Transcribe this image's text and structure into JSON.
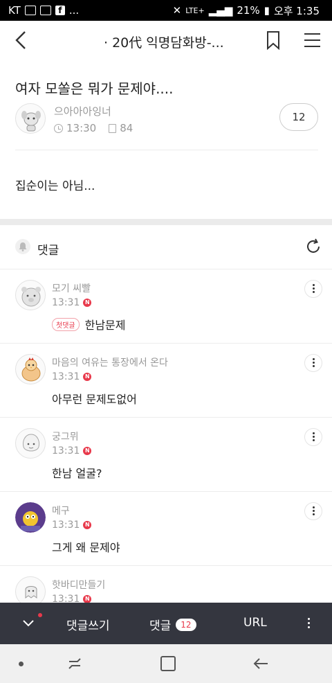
{
  "status_bar": {
    "carrier": "KT",
    "network": "LTE+",
    "battery": "21%",
    "time": "오후 1:35"
  },
  "app_bar": {
    "title": "· 20代 익명담화방-..."
  },
  "post": {
    "title": "여자 모쏠은 뭐가 문제야....",
    "author": "으아아아잉너",
    "time": "13:30",
    "views": "84",
    "comment_count": "12",
    "body": "집순이는 아님..."
  },
  "comments_section": {
    "label": "댓글"
  },
  "comments": [
    {
      "name": "모기 씨빨",
      "time": "13:31",
      "first_badge": "첫댓글",
      "text": "한남문제"
    },
    {
      "name": "마음의 여유는 통장에서 온다",
      "time": "13:31",
      "text": "아무런 문제도없어"
    },
    {
      "name": "궁그뮈",
      "time": "13:31",
      "text": "한남 얼굴?"
    },
    {
      "name": "메구",
      "time": "13:31",
      "text": "그게 왜 문제야"
    },
    {
      "name": "핫바디만들기",
      "time": "13:31",
      "text": ""
    }
  ],
  "new_badge": "N",
  "bottom_bar": {
    "write_label": "댓글쓰기",
    "comments_label": "댓글",
    "comments_count": "12",
    "url_label": "URL"
  },
  "colors": {
    "accent_red": "#e8394b",
    "bottom_bar_bg": "#34363f",
    "section_gap": "#ebebeb"
  }
}
